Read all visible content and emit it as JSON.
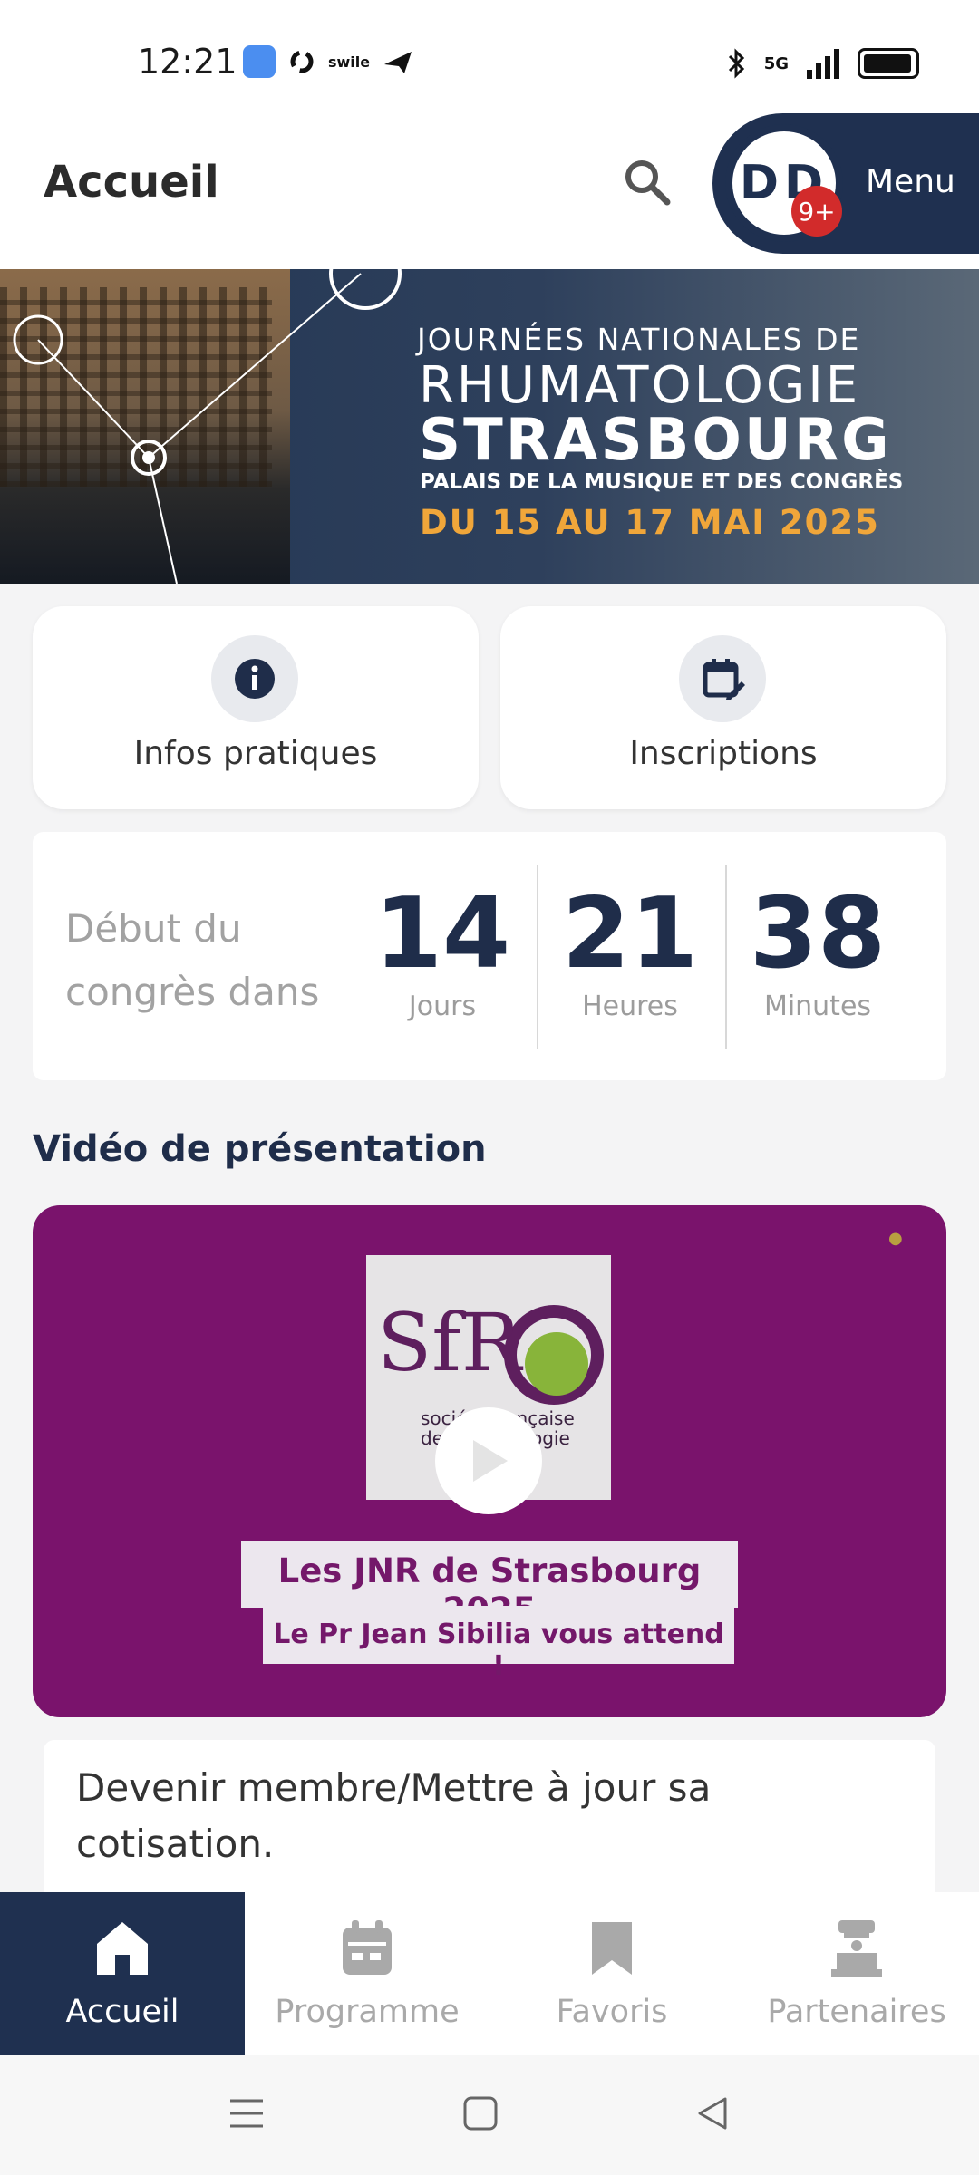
{
  "status_bar": {
    "time": "12:21",
    "swile_label": "swile",
    "network": "5G",
    "icons": [
      "weather-icon",
      "app-icon",
      "swile-icon",
      "navigation-icon",
      "bluetooth-icon",
      "signal-icon",
      "battery-icon"
    ]
  },
  "header": {
    "title": "Accueil",
    "avatar_initials": "DD",
    "badge": "9+",
    "menu_label": "Menu"
  },
  "banner": {
    "line1": "JOURNÉES NATIONALES DE",
    "line2": "RHUMATOLOGIE",
    "line3": "STRASBOURG",
    "line4": "PALAIS DE LA MUSIQUE ET DES CONGRÈS",
    "line5": "DU 15 AU 17 MAI 2025",
    "accent_color": "#f0a63a"
  },
  "quick_actions": [
    {
      "label": "Infos pratiques",
      "icon": "info-icon"
    },
    {
      "label": "Inscriptions",
      "icon": "calendar-edit-icon"
    }
  ],
  "countdown": {
    "label": "Début du congrès dans",
    "days": "14",
    "days_unit": "Jours",
    "hours": "21",
    "hours_unit": "Heures",
    "minutes": "38",
    "minutes_unit": "Minutes"
  },
  "video_section": {
    "title": "Vidéo de présentation",
    "logo_text": "SfR",
    "logo_sub1": "société française",
    "logo_sub2": "de rhumatologie",
    "video_title": "Les JNR de Strasbourg 2025",
    "video_subtitle": "Le Pr Jean Sibilia vous attend !",
    "background_color": "#7a136c"
  },
  "member_card": {
    "text": "Devenir membre/Mettre à jour sa cotisation."
  },
  "bottom_nav": [
    {
      "label": "Accueil",
      "icon": "home-icon",
      "active": true
    },
    {
      "label": "Programme",
      "icon": "calendar-icon",
      "active": false
    },
    {
      "label": "Favoris",
      "icon": "bookmark-icon",
      "active": false
    },
    {
      "label": "Partenaires",
      "icon": "booth-icon",
      "active": false
    }
  ],
  "colors": {
    "primary": "#1f3050",
    "badge": "#d22b2b"
  }
}
